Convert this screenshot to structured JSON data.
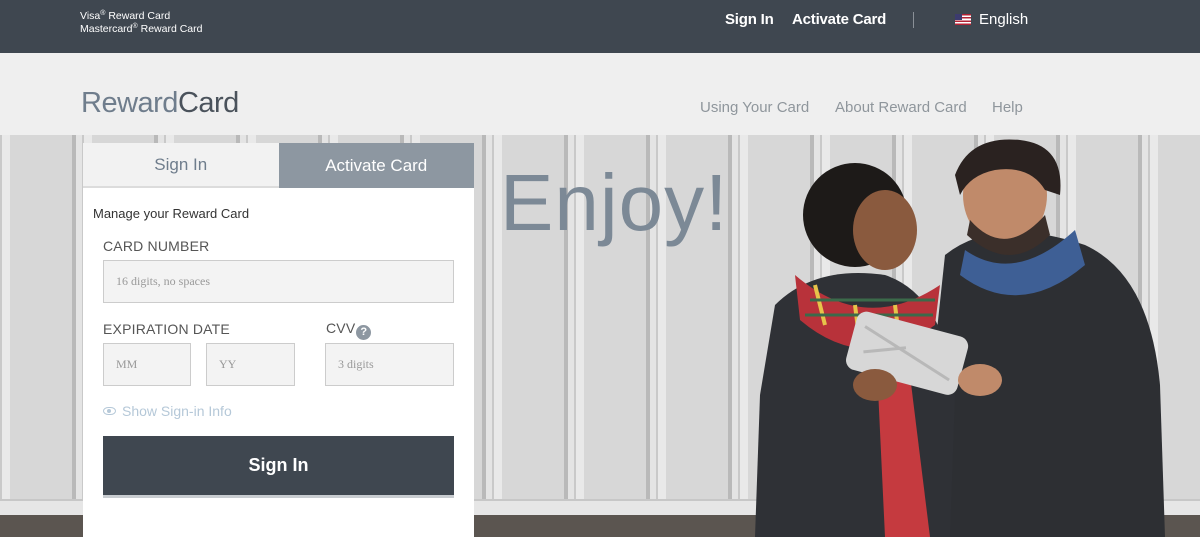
{
  "topbar": {
    "brand_line1": "Visa",
    "brand_line1_suffix": " Reward Card",
    "brand_line2": "Mastercard",
    "brand_line2_suffix": " Reward Card",
    "reg_mark": "®",
    "signin_link": "Sign In",
    "activate_link": "Activate Card",
    "language": "English"
  },
  "header": {
    "logo_part1": "Reward",
    "logo_part2": "Card",
    "nav": [
      "Using Your Card",
      "About Reward Card",
      "Help"
    ]
  },
  "hero": {
    "headline": "Enjoy!"
  },
  "panel": {
    "tab_signin": "Sign In",
    "tab_activate": "Activate Card",
    "manage_text": "Manage your Reward Card",
    "card_number_label": "CARD NUMBER",
    "card_number_placeholder": "16 digits, no spaces",
    "expiration_label": "EXPIRATION DATE",
    "month_placeholder": "MM",
    "year_placeholder": "YY",
    "cvv_label": "CVV",
    "cvv_help": "?",
    "cvv_placeholder": "3 digits",
    "show_info": "Show Sign-in Info",
    "submit": "Sign In"
  },
  "colors": {
    "topbar_bg": "#3f4750",
    "header_bg": "#efefef",
    "tab_inactive_bg": "#8d97a1",
    "button_bg": "#3f4750",
    "logo_accent": "#6f7d8c"
  }
}
